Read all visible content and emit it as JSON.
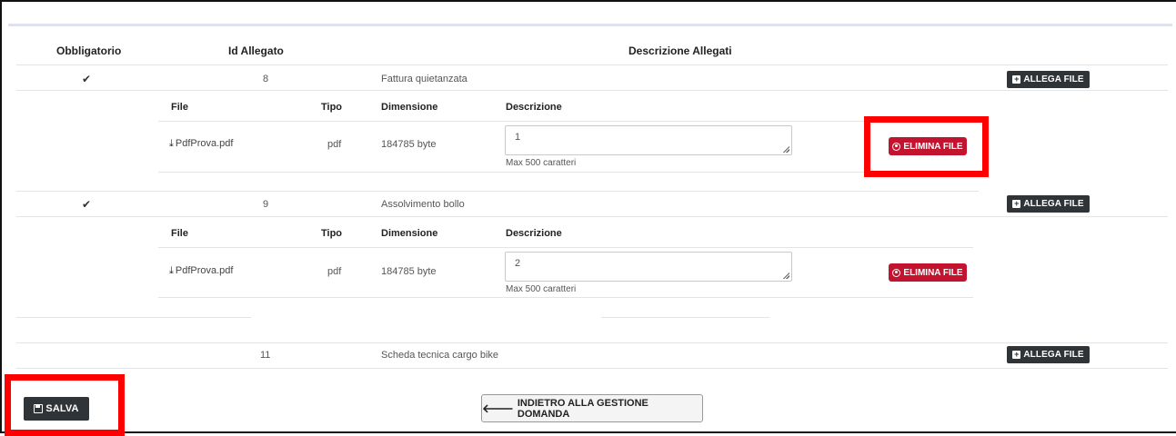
{
  "table": {
    "headers": {
      "obbligatorio": "Obbligatorio",
      "id_allegato": "Id Allegato",
      "descrizione_allegati": "Descrizione Allegati"
    },
    "sub_headers": {
      "file": "File",
      "tipo": "Tipo",
      "dimensione": "Dimensione",
      "descrizione": "Descrizione"
    },
    "rows": [
      {
        "obbligatorio": "✔",
        "id": "8",
        "descrizione": "Fattura quietanzata",
        "allega_label": "ALLEGA FILE",
        "file": {
          "name": "PdfProva.pdf",
          "tipo": "pdf",
          "dimensione": "184785 byte",
          "descrizione_value": "1",
          "max_hint": "Max 500 caratteri",
          "elimina_label": "ELIMINA FILE"
        }
      },
      {
        "obbligatorio": "✔",
        "id": "9",
        "descrizione": "Assolvimento bollo",
        "allega_label": "ALLEGA FILE",
        "file": {
          "name": "PdfProva.pdf",
          "tipo": "pdf",
          "dimensione": "184785 byte",
          "descrizione_value": "2",
          "max_hint": "Max 500 caratteri",
          "elimina_label": "ELIMINA FILE"
        }
      },
      {
        "obbligatorio": "",
        "id": "11",
        "descrizione": "Scheda tecnica cargo bike",
        "allega_label": "ALLEGA FILE"
      }
    ]
  },
  "footer": {
    "salva_label": "SALVA",
    "indietro_label": "INDIETRO ALLA GESTIONE DOMANDA"
  },
  "colors": {
    "highlight": "#ff0000",
    "danger": "#c2142f",
    "dark_button": "#2f3438"
  }
}
